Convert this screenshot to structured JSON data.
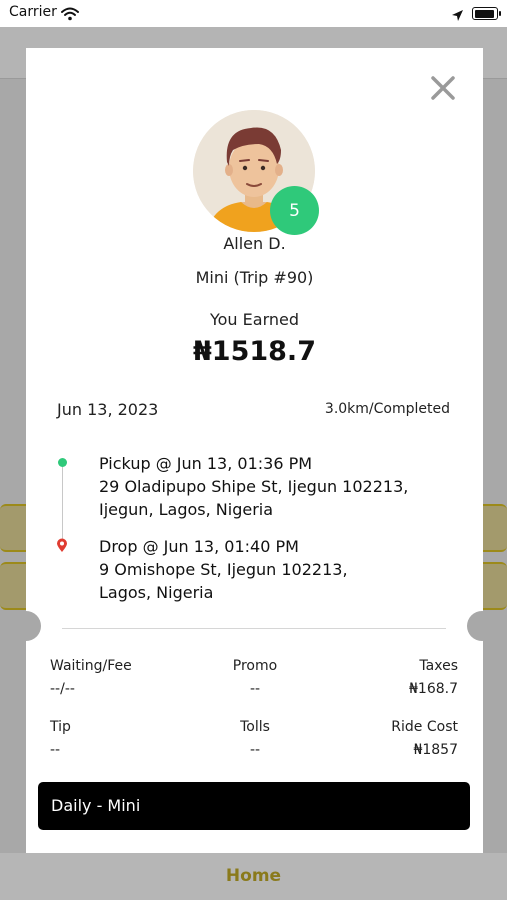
{
  "status_bar": {
    "carrier": "Carrier"
  },
  "driver": {
    "name": "Allen D.",
    "rating": "5"
  },
  "trip": {
    "info": "Mini  (Trip #90)",
    "earned_label": "You Earned",
    "earned_amount": "₦1518.7",
    "date": "Jun 13, 2023",
    "distance_status": "3.0km/Completed",
    "pickup": {
      "title": "Pickup @ Jun 13, 01:36 PM",
      "address_line1": "29 Oladipupo Shipe St, Ijegun 102213,",
      "address_line2": "Ijegun, Lagos, Nigeria"
    },
    "drop": {
      "title": "Drop @ Jun 13, 01:40 PM",
      "address_line1": "9 Omishope St, Ijegun 102213,",
      "address_line2": "Lagos, Nigeria"
    }
  },
  "fees": {
    "waiting_fee": {
      "label": "Waiting/Fee",
      "value": "--/--"
    },
    "promo": {
      "label": "Promo",
      "value": "--"
    },
    "taxes": {
      "label": "Taxes",
      "value": "₦168.7"
    },
    "tip": {
      "label": "Tip",
      "value": "--"
    },
    "tolls": {
      "label": "Tolls",
      "value": "--"
    },
    "ride_cost": {
      "label": "Ride Cost",
      "value": "₦1857"
    }
  },
  "plan": {
    "label": "Daily - Mini"
  },
  "bottom_nav": {
    "home_label": "Home"
  },
  "icons": {
    "close": "close-icon",
    "pickup": "pickup-dot-icon",
    "drop": "location-pin-icon",
    "wifi": "wifi-icon",
    "location": "location-arrow-icon",
    "battery": "battery-icon"
  },
  "colors": {
    "accent_green": "#2fc97a",
    "drop_red": "#e03c31",
    "plan_bar": "#000000",
    "home_gold": "#8a7a1c"
  }
}
